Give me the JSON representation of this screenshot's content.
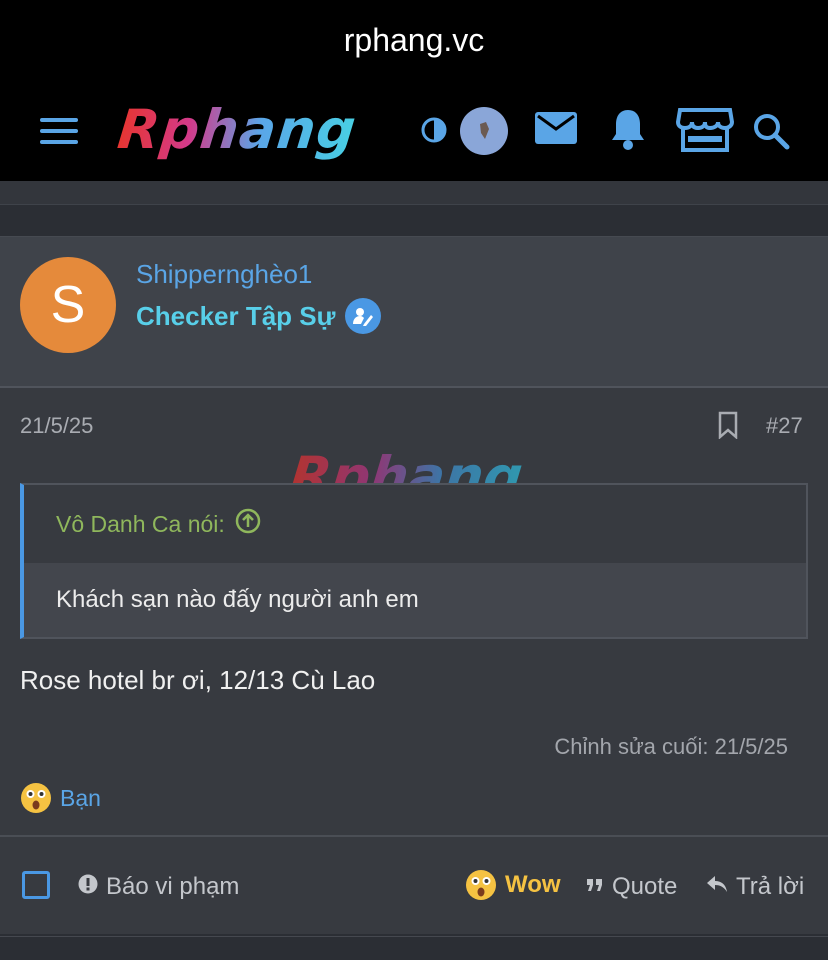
{
  "browser": {
    "url": "rphang.vc"
  },
  "header": {
    "logo_text": "Rphang",
    "icons": [
      "menu-icon",
      "contrast-icon",
      "avatar",
      "mail-icon",
      "bell-icon",
      "store-icon",
      "search-icon"
    ]
  },
  "post": {
    "author": {
      "avatar_letter": "S",
      "name": "Shippernghèo1",
      "title": "Checker Tập Sự"
    },
    "date": "21/5/25",
    "number": "#27",
    "watermark": "Rphang",
    "quote": {
      "attribution": "Vô Danh Ca nói:",
      "text": "Khách sạn nào đấy người anh em"
    },
    "message": "Rose hotel br ơi, 12/13 Cù Lao",
    "edited": "Chỉnh sửa cuối: 21/5/25",
    "reactions": {
      "label": "Bạn"
    },
    "actions": {
      "report": "Báo vi phạm",
      "wow": "Wow",
      "quote": "Quote",
      "reply": "Trả lời"
    }
  },
  "colors": {
    "accent": "#4a98e4",
    "username": "#5aa5e6",
    "user_title": "#58cfe9",
    "quote_attr": "#8fb75c",
    "wow": "#f5c242",
    "avatar_bg": "#e58a3b"
  }
}
